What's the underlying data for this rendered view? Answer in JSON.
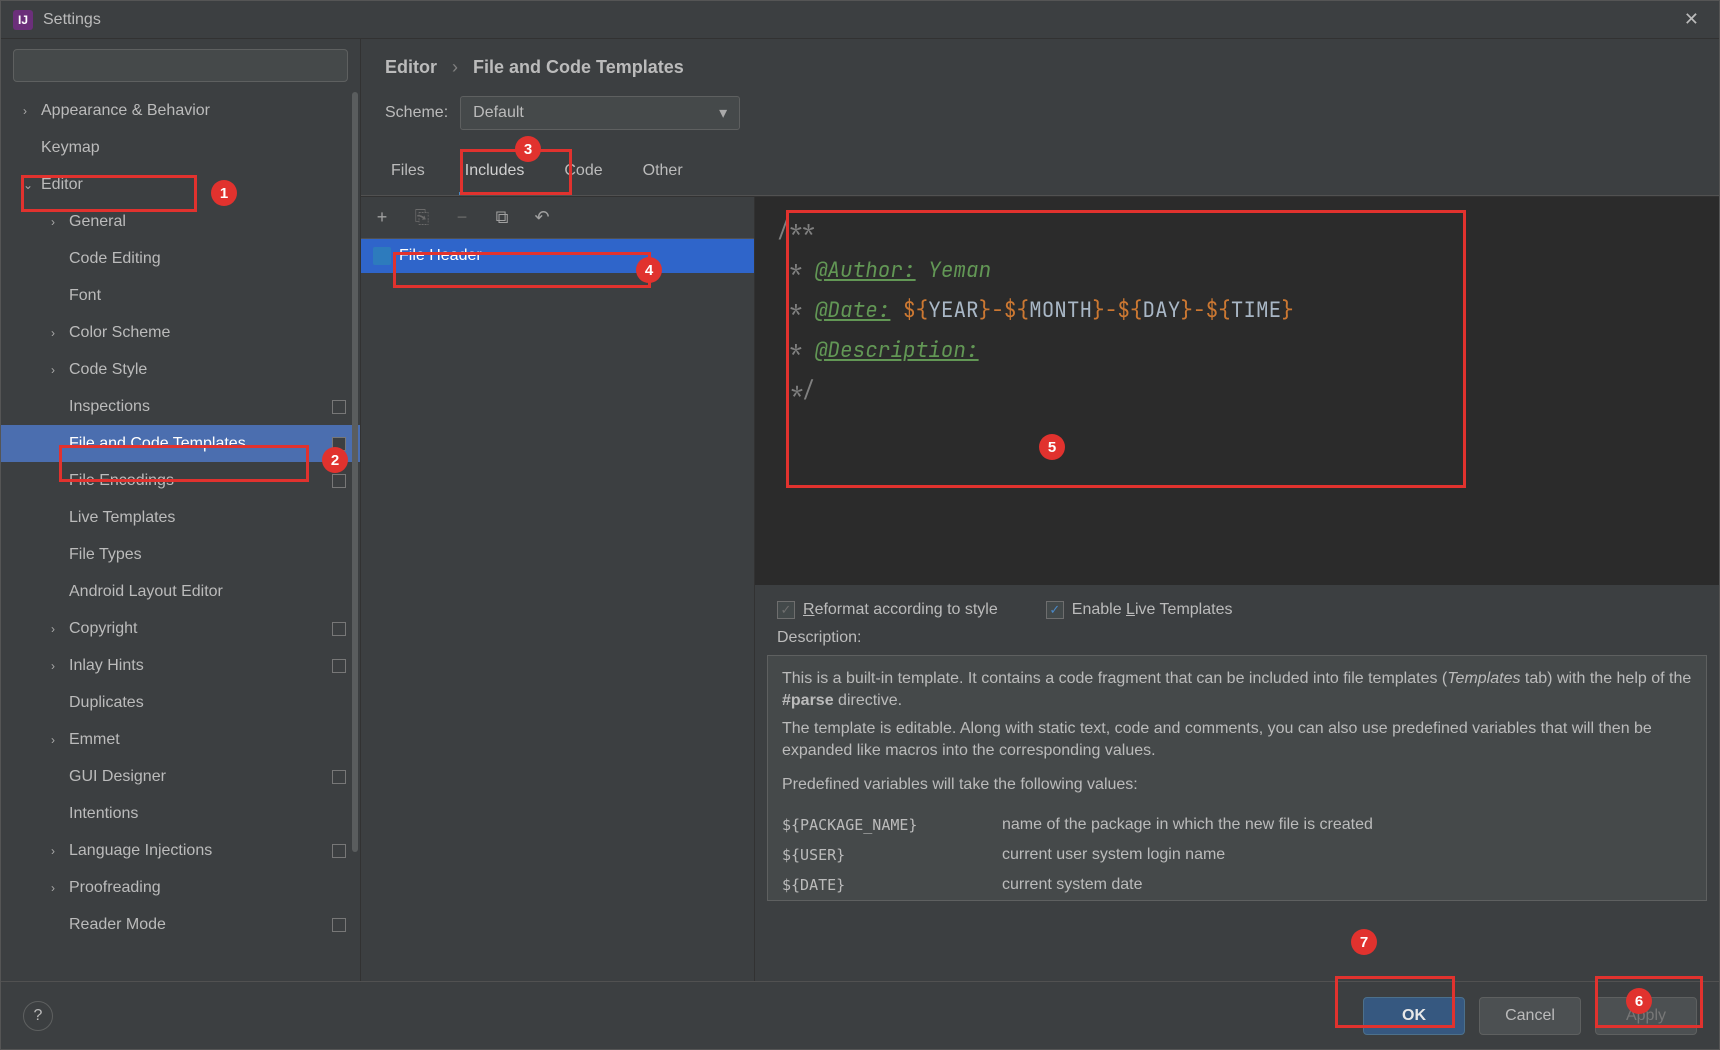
{
  "window": {
    "title": "Settings"
  },
  "sidebar": {
    "search_placeholder": "",
    "items": [
      {
        "label": "Appearance & Behavior",
        "chev": "›",
        "level": 1
      },
      {
        "label": "Keymap",
        "chev": "",
        "level": 1
      },
      {
        "label": "Editor",
        "chev": "⌄",
        "level": 1
      },
      {
        "label": "General",
        "chev": "›",
        "level": 2
      },
      {
        "label": "Code Editing",
        "chev": "",
        "level": 2
      },
      {
        "label": "Font",
        "chev": "",
        "level": 2
      },
      {
        "label": "Color Scheme",
        "chev": "›",
        "level": 2
      },
      {
        "label": "Code Style",
        "chev": "›",
        "level": 2
      },
      {
        "label": "Inspections",
        "chev": "",
        "level": 2,
        "badge": true
      },
      {
        "label": "File and Code Templates",
        "chev": "",
        "level": 2,
        "badge": true,
        "selected": true
      },
      {
        "label": "File Encodings",
        "chev": "",
        "level": 2,
        "badge": true
      },
      {
        "label": "Live Templates",
        "chev": "",
        "level": 2
      },
      {
        "label": "File Types",
        "chev": "",
        "level": 2
      },
      {
        "label": "Android Layout Editor",
        "chev": "",
        "level": 2
      },
      {
        "label": "Copyright",
        "chev": "›",
        "level": 2,
        "badge": true
      },
      {
        "label": "Inlay Hints",
        "chev": "›",
        "level": 2,
        "badge": true
      },
      {
        "label": "Duplicates",
        "chev": "",
        "level": 2
      },
      {
        "label": "Emmet",
        "chev": "›",
        "level": 2
      },
      {
        "label": "GUI Designer",
        "chev": "",
        "level": 2,
        "badge": true
      },
      {
        "label": "Intentions",
        "chev": "",
        "level": 2
      },
      {
        "label": "Language Injections",
        "chev": "›",
        "level": 2,
        "badge": true
      },
      {
        "label": "Proofreading",
        "chev": "›",
        "level": 2
      },
      {
        "label": "Reader Mode",
        "chev": "",
        "level": 2,
        "badge": true
      }
    ]
  },
  "breadcrumb": {
    "a": "Editor",
    "b": "File and Code Templates"
  },
  "scheme": {
    "label": "Scheme:",
    "value": "Default"
  },
  "tabs": [
    "Files",
    "Includes",
    "Code",
    "Other"
  ],
  "list": {
    "items": [
      "File Header"
    ]
  },
  "code": {
    "author_tag": "@Author:",
    "author_val": "Yeman",
    "date_tag": "@Date:",
    "desc_tag": "@Description:",
    "var_year": "YEAR",
    "var_month": "MONTH",
    "var_day": "DAY",
    "var_time": "TIME"
  },
  "checks": {
    "reformat": "Reformat according to style",
    "live": "Enable Live Templates"
  },
  "desc": {
    "label": "Description:",
    "p1a": "This is a built-in template. It contains a code fragment that can be included into file templates (",
    "p1b": "Templates",
    "p1c": " tab) with the help of the ",
    "p1d": "#parse",
    "p1e": " directive.",
    "p2": "The template is editable. Along with static text, code and comments, you can also use predefined variables that will then be expanded like macros into the corresponding values.",
    "p3": "Predefined variables will take the following values:",
    "vars": [
      {
        "k": "${PACKAGE_NAME}",
        "v": "name of the package in which the new file is created"
      },
      {
        "k": "${USER}",
        "v": "current user system login name"
      },
      {
        "k": "${DATE}",
        "v": "current system date"
      }
    ]
  },
  "buttons": {
    "ok": "OK",
    "cancel": "Cancel",
    "apply": "Apply"
  },
  "annotations": {
    "n1": "1",
    "n2": "2",
    "n3": "3",
    "n4": "4",
    "n5": "5",
    "n6": "6",
    "n7": "7"
  }
}
